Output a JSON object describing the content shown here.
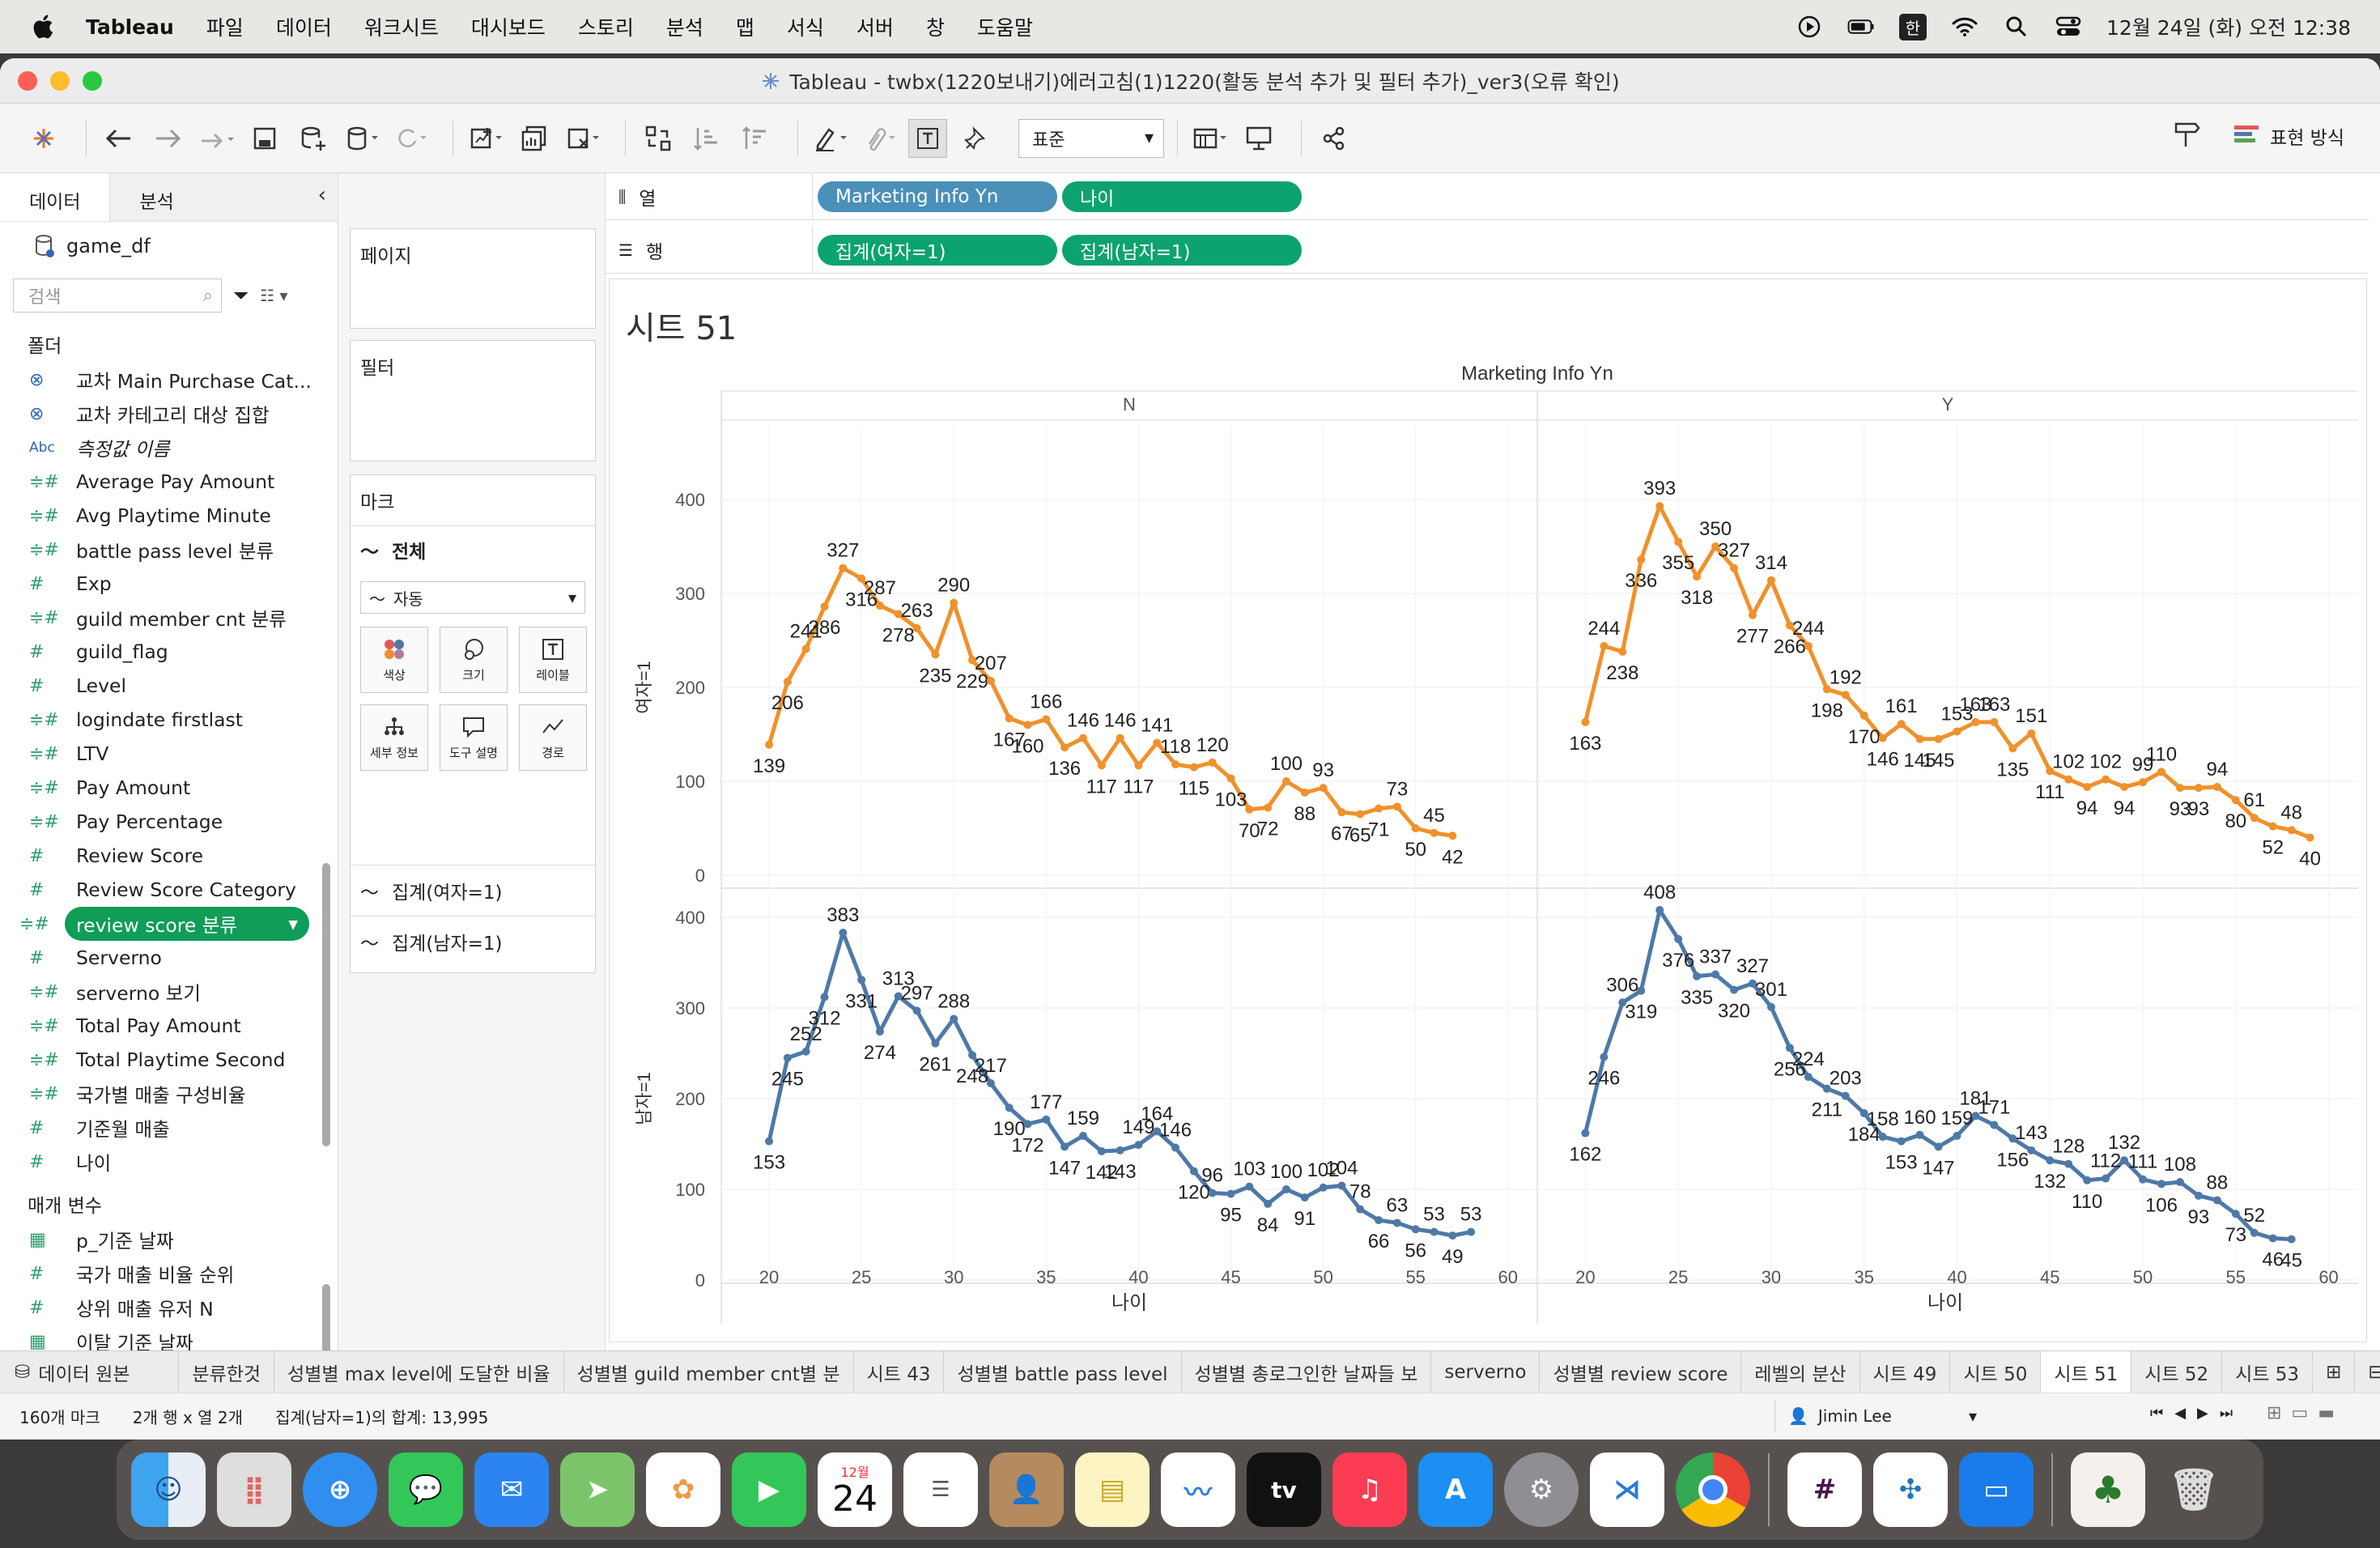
{
  "menubar": {
    "app": "Tableau",
    "items": [
      "파일",
      "데이터",
      "워크시트",
      "대시보드",
      "스토리",
      "분석",
      "맵",
      "서식",
      "서버",
      "창",
      "도움말"
    ],
    "ime": "한",
    "clock": "12월 24일 (화) 오전 12:38"
  },
  "window": {
    "title": "Tableau - twbx(1220보내기)에러고침(1)1220(활동 분석 추가 및 필터 추가)_ver3(오류 확인)"
  },
  "toolbar": {
    "fit_select": "표준",
    "show_me": "표현 방식"
  },
  "datapane": {
    "tab_data": "데이터",
    "tab_analysis": "분석",
    "source": "game_df",
    "search_placeholder": "검색",
    "folders_label": "폴더",
    "fields": [
      {
        "name": "교차 Main Purchase Cat...",
        "type": "set"
      },
      {
        "name": "교차 카테고리 대상 집합",
        "type": "set"
      },
      {
        "name": "측정값 이름",
        "type": "abc"
      },
      {
        "name": "Average Pay Amount",
        "type": "measure"
      },
      {
        "name": "Avg Playtime Minute",
        "type": "measure"
      },
      {
        "name": "battle pass level 분류",
        "type": "measure"
      },
      {
        "name": "Exp",
        "type": "hash"
      },
      {
        "name": "guild member cnt 분류",
        "type": "measure"
      },
      {
        "name": "guild_flag",
        "type": "hash"
      },
      {
        "name": "Level",
        "type": "hash"
      },
      {
        "name": "logindate firstlast",
        "type": "measure"
      },
      {
        "name": "LTV",
        "type": "measure"
      },
      {
        "name": "Pay Amount",
        "type": "measure"
      },
      {
        "name": "Pay Percentage",
        "type": "measure"
      },
      {
        "name": "Review Score",
        "type": "hash"
      },
      {
        "name": "Review Score Category",
        "type": "hash"
      },
      {
        "name": "review score 분류",
        "type": "measure",
        "selected": true
      },
      {
        "name": "Serverno",
        "type": "hash"
      },
      {
        "name": "serverno 보기",
        "type": "measure"
      },
      {
        "name": "Total Pay Amount",
        "type": "measure"
      },
      {
        "name": "Total Playtime Second",
        "type": "measure"
      },
      {
        "name": "국가별 매출 구성비율",
        "type": "measure"
      },
      {
        "name": "기준월 매출",
        "type": "hash"
      },
      {
        "name": "나이",
        "type": "hash"
      }
    ],
    "params_label": "매개 변수",
    "params": [
      {
        "name": "p_기준 날짜",
        "type": "cal"
      },
      {
        "name": "국가 매출 비율 순위",
        "type": "hash"
      },
      {
        "name": "상위 매출 유저 N",
        "type": "hash"
      },
      {
        "name": "이탈 기준 날짜",
        "type": "cal"
      }
    ]
  },
  "shelves": {
    "pages": "페이지",
    "filters": "필터",
    "marks": "마크",
    "marks_all": "전체",
    "mark_type": "자동",
    "mark_buttons": [
      "색상",
      "크기",
      "레이블",
      "세부 정보",
      "도구 설명",
      "경로"
    ],
    "mark_measures": [
      "집계(여자=1)",
      "집계(남자=1)"
    ],
    "columns_label": "열",
    "rows_label": "행",
    "columns_pills": [
      "Marketing Info Yn",
      "나이"
    ],
    "rows_pills": [
      "집계(여자=1)",
      "집계(남자=1)"
    ]
  },
  "sheet": {
    "title": "시트 51",
    "header": "Marketing Info Yn",
    "x_label": "나이",
    "colors": {
      "female": "#f0912b",
      "male": "#4e79a7"
    }
  },
  "chart_data": [
    {
      "type": "line",
      "panel": "N",
      "measure": "여자=1",
      "x": [
        20,
        21,
        22,
        23,
        24,
        25,
        26,
        27,
        28,
        29,
        30,
        31,
        32,
        33,
        34,
        35,
        36,
        37,
        38,
        39,
        40,
        41,
        42,
        43,
        44,
        45,
        46,
        47,
        48,
        49,
        50,
        51,
        52,
        53,
        54,
        55,
        56,
        57,
        58,
        59
      ],
      "values": [
        139,
        206,
        241,
        286,
        327,
        316,
        287,
        278,
        263,
        235,
        290,
        229,
        207,
        167,
        160,
        166,
        136,
        146,
        117,
        146,
        117,
        141,
        118,
        115,
        120,
        103,
        70,
        72,
        100,
        88,
        93,
        67,
        65,
        71,
        73,
        50,
        45,
        42,
        null,
        null
      ],
      "ylabel": "여자=1",
      "xlabel": "나이",
      "ylim": [
        0,
        400
      ]
    },
    {
      "type": "line",
      "panel": "Y",
      "measure": "여자=1",
      "x": [
        20,
        21,
        22,
        23,
        24,
        25,
        26,
        27,
        28,
        29,
        30,
        31,
        32,
        33,
        34,
        35,
        36,
        37,
        38,
        39,
        40,
        41,
        42,
        43,
        44,
        45,
        46,
        47,
        48,
        49,
        50,
        51,
        52,
        53,
        54,
        55,
        56,
        57,
        58,
        59
      ],
      "values": [
        163,
        244,
        238,
        336,
        393,
        355,
        318,
        350,
        327,
        277,
        314,
        266,
        244,
        198,
        192,
        170,
        146,
        161,
        145,
        145,
        153,
        163,
        163,
        135,
        151,
        111,
        102,
        94,
        102,
        94,
        99,
        110,
        93,
        93,
        94,
        80,
        61,
        52,
        48,
        40
      ],
      "ylabel": "여자=1",
      "xlabel": "나이",
      "ylim": [
        0,
        400
      ]
    },
    {
      "type": "line",
      "panel": "N",
      "measure": "남자=1",
      "x": [
        20,
        21,
        22,
        23,
        24,
        25,
        26,
        27,
        28,
        29,
        30,
        31,
        32,
        33,
        34,
        35,
        36,
        37,
        38,
        39,
        40,
        41,
        42,
        43,
        44,
        45,
        46,
        47,
        48,
        49,
        50,
        51,
        52,
        53,
        54,
        55,
        56,
        57,
        58,
        59
      ],
      "values": [
        153,
        245,
        252,
        312,
        383,
        331,
        274,
        313,
        297,
        261,
        288,
        248,
        217,
        190,
        172,
        177,
        147,
        159,
        142,
        143,
        149,
        164,
        146,
        120,
        96,
        95,
        103,
        84,
        100,
        91,
        102,
        104,
        78,
        66,
        63,
        56,
        53,
        49,
        53,
        null
      ],
      "ylabel": "남자=1",
      "xlabel": "나이",
      "ylim": [
        0,
        400
      ]
    },
    {
      "type": "line",
      "panel": "Y",
      "measure": "남자=1",
      "x": [
        20,
        21,
        22,
        23,
        24,
        25,
        26,
        27,
        28,
        29,
        30,
        31,
        32,
        33,
        34,
        35,
        36,
        37,
        38,
        39,
        40,
        41,
        42,
        43,
        44,
        45,
        46,
        47,
        48,
        49,
        50,
        51,
        52,
        53,
        54,
        55,
        56,
        57,
        58,
        59
      ],
      "values": [
        162,
        246,
        306,
        319,
        408,
        376,
        335,
        337,
        320,
        327,
        301,
        256,
        224,
        211,
        203,
        184,
        158,
        153,
        160,
        147,
        159,
        181,
        171,
        156,
        143,
        132,
        128,
        110,
        112,
        132,
        111,
        106,
        108,
        93,
        88,
        73,
        52,
        46,
        45,
        null
      ],
      "ylabel": "남자=1",
      "xlabel": "나이",
      "ylim": [
        0,
        400
      ]
    }
  ],
  "sheettabs": {
    "source": "데이터 원본",
    "tabs": [
      "분류한것",
      "성별별 max level에 도달한 비율",
      "성별별 guild member cnt별 분",
      "시트 43",
      "성별별 battle pass level",
      "성별별 총로그인한 날짜들 보",
      "serverno",
      "성별별 review score",
      "레벨의 분산",
      "시트 49",
      "시트 50",
      "시트 51",
      "시트 52",
      "시트 53"
    ],
    "active": "시트 51"
  },
  "status": {
    "marks": "160개 마크",
    "grid": "2개 행 x 열 2개",
    "sum": "집계(남자=1)의 합계: 13,995",
    "user": "Jimin Lee"
  },
  "dock": {
    "calendar_month": "12월",
    "calendar_day": "24",
    "apps": [
      "finder-icon",
      "launchpad-icon",
      "safari-icon",
      "messages-icon",
      "mail-icon",
      "maps-icon",
      "photos-icon",
      "facetime-icon",
      "calendar-icon",
      "reminders-icon",
      "contacts-icon",
      "notes-icon",
      "freeform-icon",
      "tv-icon",
      "music-icon",
      "appstore-icon",
      "settings-icon",
      "vscode-icon",
      "chrome-icon",
      "slack-icon",
      "tableau-icon",
      "keynote-icon",
      "christmas-tree-icon",
      "trash-icon"
    ]
  }
}
